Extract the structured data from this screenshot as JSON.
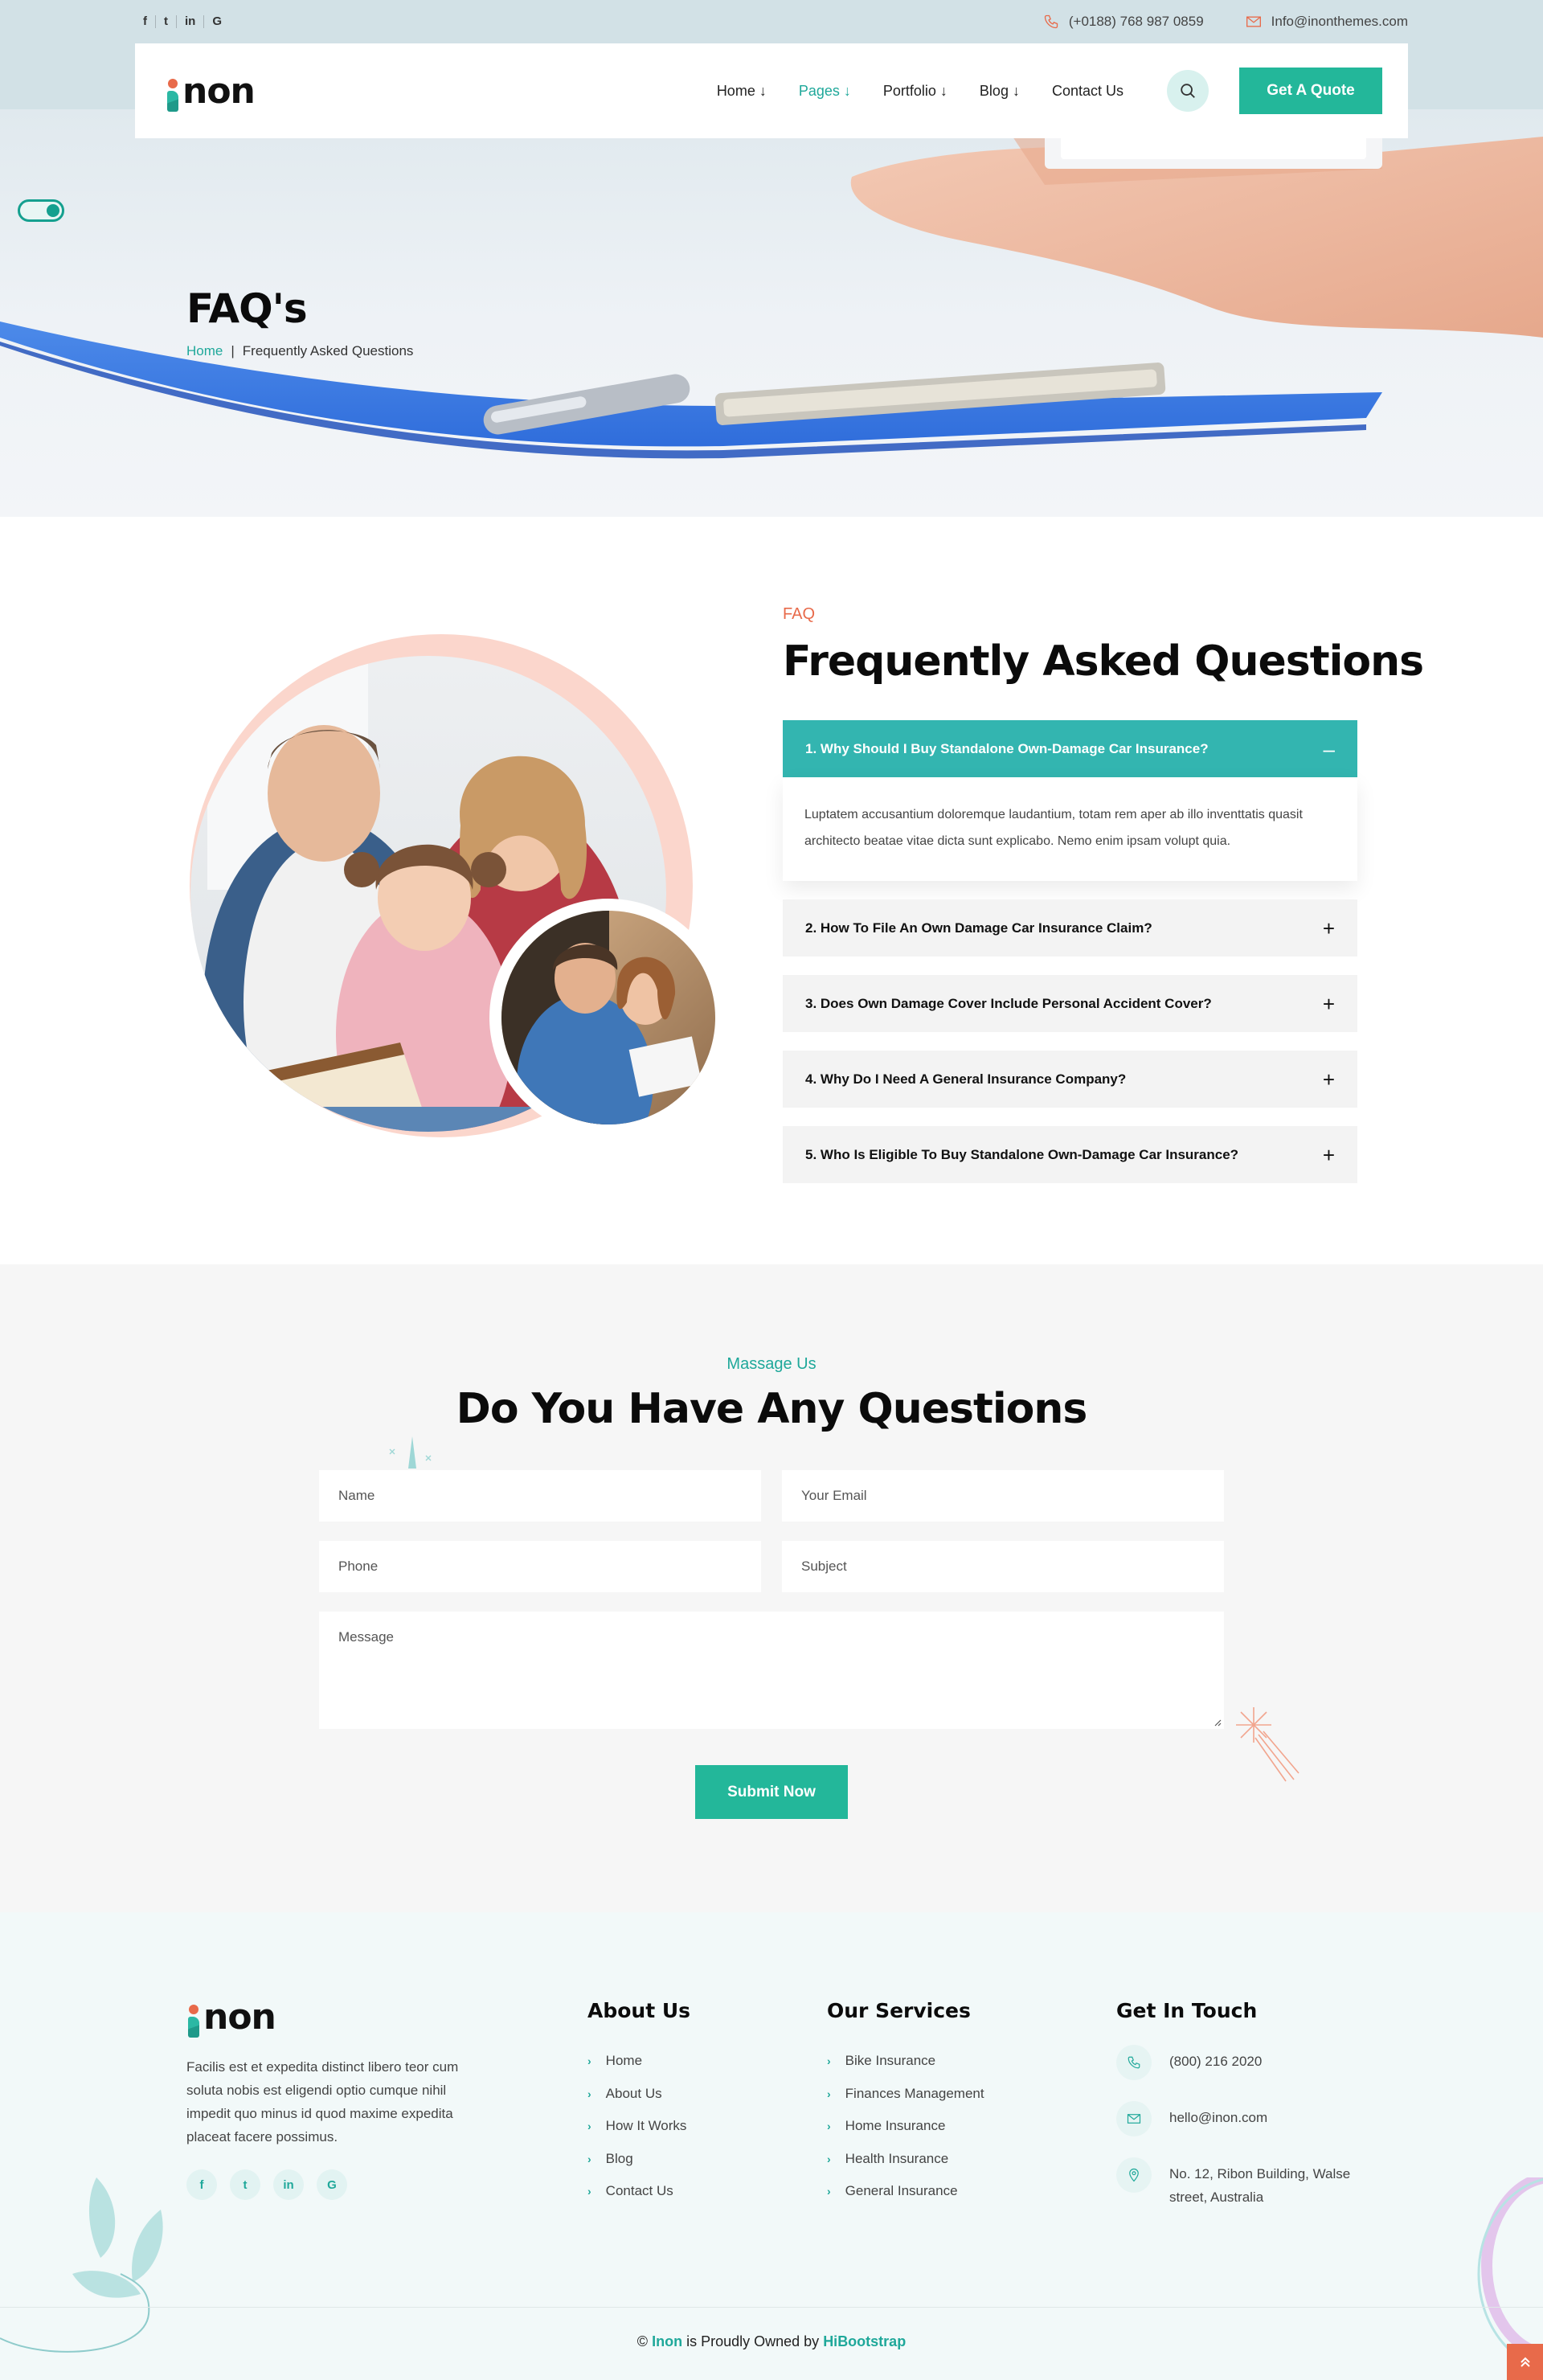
{
  "topbar": {
    "social": [
      "f",
      "t",
      "in",
      "G"
    ],
    "phone": "(+0188) 768 987 0859",
    "email": "Info@inonthemes.com"
  },
  "nav": {
    "logo": "non",
    "items": [
      "Home ↓",
      "Pages ↓",
      "Portfolio ↓",
      "Blog ↓",
      "Contact Us"
    ],
    "active_index": 1,
    "quote_label": "Get A Quote"
  },
  "hero": {
    "title": "FAQ's",
    "breadcrumb_home": "Home",
    "breadcrumb_sep": "|",
    "breadcrumb_current": "Frequently Asked Questions"
  },
  "faq": {
    "eyebrow": "FAQ",
    "title": "Frequently Asked Questions",
    "items": [
      {
        "q": "1. Why Should I Buy Standalone Own-Damage Car Insurance?",
        "sign": "–"
      },
      {
        "q": "2. How To File An Own Damage Car Insurance Claim?",
        "sign": "+"
      },
      {
        "q": "3. Does Own Damage Cover Include Personal Accident Cover?",
        "sign": "+"
      },
      {
        "q": "4. Why Do I Need A General Insurance Company?",
        "sign": "+"
      },
      {
        "q": "5. Who Is Eligible To Buy Standalone Own-Damage Car Insurance?",
        "sign": "+"
      }
    ],
    "answer": "Luptatem accusantium doloremque laudantium, totam rem aper ab illo inventtatis quasit architecto beatae vitae dicta sunt explicabo. Nemo enim ipsam volupt quia."
  },
  "contact": {
    "eyebrow": "Massage Us",
    "title": "Do You Have Any Questions",
    "name_ph": "Name",
    "email_ph": "Your Email",
    "phone_ph": "Phone",
    "subject_ph": "Subject",
    "message_ph": "Message",
    "submit": "Submit Now"
  },
  "footer": {
    "logo": "non",
    "desc": "Facilis est et expedita distinct libero teor cum soluta nobis est eligendi optio cumque nihil impedit quo minus id quod maxime expedita placeat facere possimus.",
    "social": [
      "f",
      "t",
      "in",
      "G"
    ],
    "about": {
      "title": "About Us",
      "links": [
        "Home",
        "About Us",
        "How It Works",
        "Blog",
        "Contact Us"
      ]
    },
    "services": {
      "title": "Our Services",
      "links": [
        "Bike Insurance",
        "Finances Management",
        "Home Insurance",
        "Health Insurance",
        "General Insurance"
      ]
    },
    "touch": {
      "title": "Get In Touch",
      "phone": "(800) 216 2020",
      "email": "hello@inon.com",
      "address": "No. 12, Ribon Building, Walse street, Australia"
    },
    "copy_prefix": "©",
    "copy_brand": "Inon",
    "copy_mid": "is Proudly Owned by",
    "copy_owner": "HiBootstrap"
  },
  "colors": {
    "accent": "#23b79a",
    "teal": "#33b5b0",
    "coral": "#e86a4a"
  }
}
